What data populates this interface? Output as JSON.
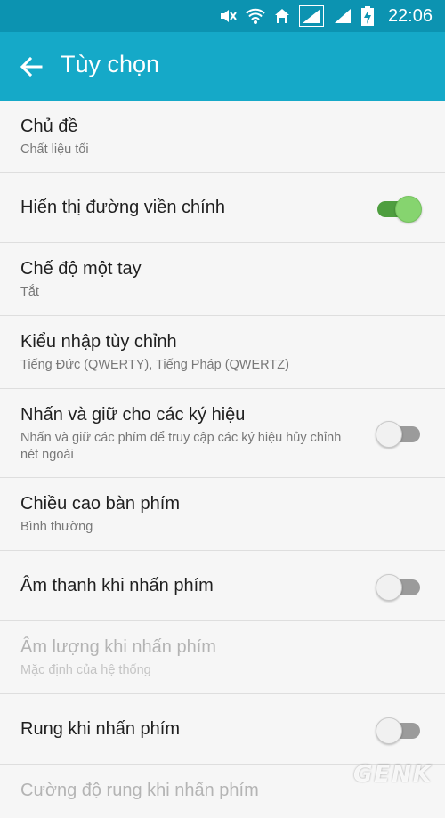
{
  "status_bar": {
    "time": "22:06",
    "icons": [
      "mute-icon",
      "wifi-icon",
      "home-sync-icon",
      "signal-icon",
      "signal-icon",
      "battery-charging-icon"
    ]
  },
  "app_bar": {
    "back_icon": "arrow-left-icon",
    "title": "Tùy chọn"
  },
  "settings": [
    {
      "title": "Chủ đề",
      "summary": "Chất liệu tối"
    },
    {
      "title": "Hiển thị đường viền chính",
      "toggle": true
    },
    {
      "title": "Chế độ một tay",
      "summary": "Tắt"
    },
    {
      "title": "Kiểu nhập tùy chỉnh",
      "summary": "Tiếng Đức (QWERTY), Tiếng Pháp (QWERTZ)"
    },
    {
      "title": "Nhấn và giữ cho các ký hiệu",
      "summary_line1": "Nhấn và giữ các phím để truy cập các ký hiệu hủy chỉnh",
      "summary_line2": "nét ngoài",
      "toggle": false
    },
    {
      "title": "Chiều cao bàn phím",
      "summary": "Bình thường"
    },
    {
      "title": "Âm thanh khi nhấn phím",
      "toggle": false
    },
    {
      "title": "Âm lượng khi nhấn phím",
      "summary": "Mặc định của hệ thống",
      "disabled": true
    },
    {
      "title": "Rung khi nhấn phím",
      "toggle": false
    },
    {
      "title": "Cường độ rung khi nhấn phím",
      "disabled": true
    }
  ],
  "watermark": "GENK",
  "colors": {
    "status_bar": "#0c93b1",
    "app_bar": "#15a9c8",
    "toggle_on": "#86d46f",
    "toggle_off": "#9b9b9b"
  }
}
